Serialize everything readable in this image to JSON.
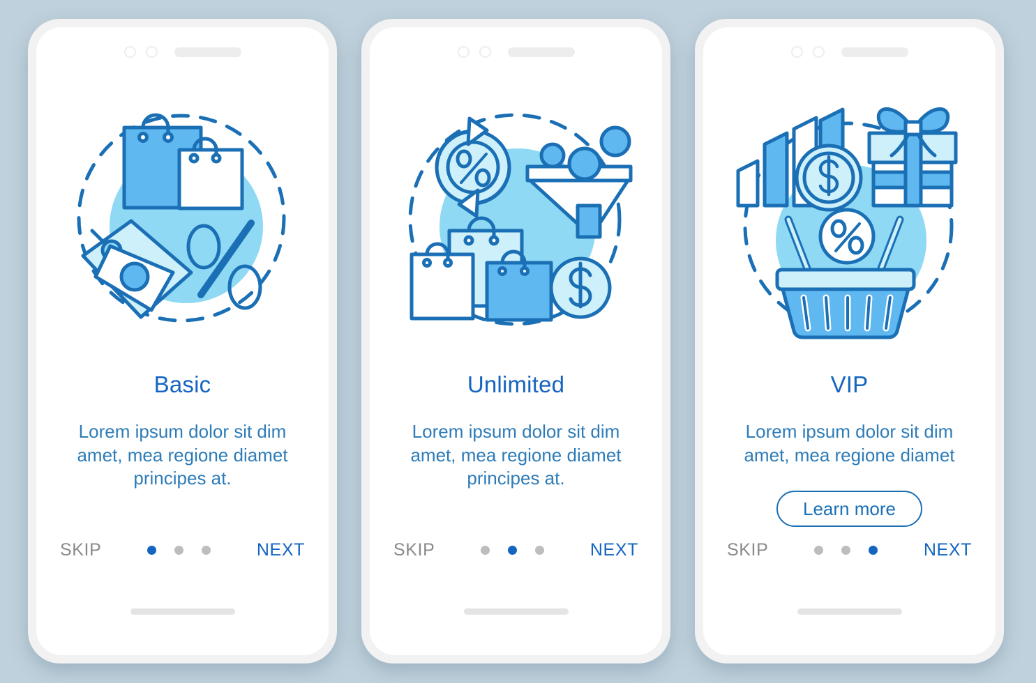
{
  "background_color": "#bfd1dc",
  "palette": {
    "title_blue": "#1565c0",
    "body_blue": "#2d7cb8",
    "stroke_blue": "#1a6fb5",
    "fill_mid_blue": "#5fb8f0",
    "fill_light_blue": "#8fd9f5",
    "fill_pale_blue": "#cdf0fb",
    "skip_gray": "#8a8a8a",
    "dot_inactive": "#bdbdbd",
    "card_bezel": "#f2f2f2"
  },
  "screens": [
    {
      "id": "basic",
      "illustration_name": "shopping-bags-price-tag-percent-illustration",
      "title": "Basic",
      "description": "Lorem ipsum dolor sit dim amet, mea regione diamet principes at.",
      "has_learn_more": false,
      "learn_more_label": "",
      "skip_label": "SKIP",
      "next_label": "NEXT",
      "dots_total": 3,
      "dot_active_index": 0
    },
    {
      "id": "unlimited",
      "illustration_name": "refresh-percent-funnel-bags-dollar-illustration",
      "title": "Unlimited",
      "description": "Lorem ipsum dolor sit dim amet, mea regione diamet principes at.",
      "has_learn_more": false,
      "learn_more_label": "",
      "skip_label": "SKIP",
      "next_label": "NEXT",
      "dots_total": 3,
      "dot_active_index": 1
    },
    {
      "id": "vip",
      "illustration_name": "growth-chart-coin-gift-basket-percent-illustration",
      "title": "VIP",
      "description": "Lorem ipsum dolor sit dim amet, mea regione diamet",
      "has_learn_more": true,
      "learn_more_label": "Learn more",
      "skip_label": "SKIP",
      "next_label": "NEXT",
      "dots_total": 3,
      "dot_active_index": 2
    }
  ]
}
